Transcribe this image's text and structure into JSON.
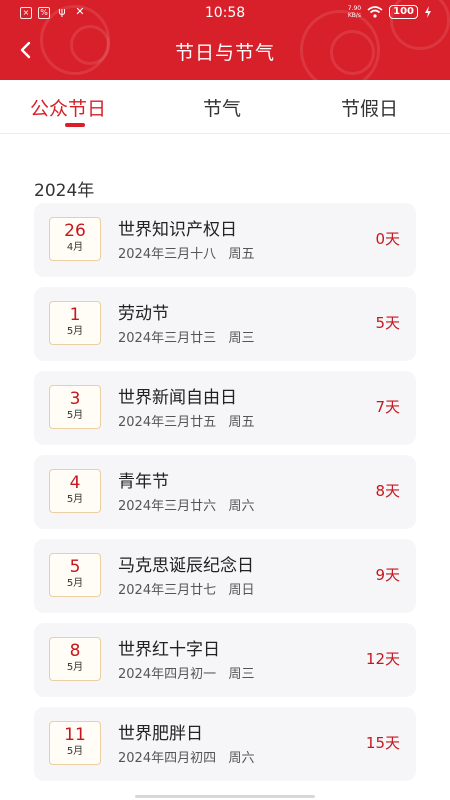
{
  "status_bar": {
    "time": "10:58",
    "net_speed_value": "7.90",
    "net_speed_unit": "KB/s",
    "battery": "100"
  },
  "header": {
    "title": "节日与节气",
    "back_icon": "chevron-left-icon",
    "color": "#d8202a"
  },
  "tabs": [
    {
      "label": "公众节日",
      "active": true
    },
    {
      "label": "节气",
      "active": false
    },
    {
      "label": "节假日",
      "active": false
    }
  ],
  "year_label": "2024年",
  "events": [
    {
      "day": "26",
      "month": "4月",
      "name": "世界知识产权日",
      "lunar": "2024年三月十八",
      "weekday": "周五",
      "countdown": "0天"
    },
    {
      "day": "1",
      "month": "5月",
      "name": "劳动节",
      "lunar": "2024年三月廿三",
      "weekday": "周三",
      "countdown": "5天"
    },
    {
      "day": "3",
      "month": "5月",
      "name": "世界新闻自由日",
      "lunar": "2024年三月廿五",
      "weekday": "周五",
      "countdown": "7天"
    },
    {
      "day": "4",
      "month": "5月",
      "name": "青年节",
      "lunar": "2024年三月廿六",
      "weekday": "周六",
      "countdown": "8天"
    },
    {
      "day": "5",
      "month": "5月",
      "name": "马克思诞辰纪念日",
      "lunar": "2024年三月廿七",
      "weekday": "周日",
      "countdown": "9天"
    },
    {
      "day": "8",
      "month": "5月",
      "name": "世界红十字日",
      "lunar": "2024年四月初一",
      "weekday": "周三",
      "countdown": "12天"
    },
    {
      "day": "11",
      "month": "5月",
      "name": "世界肥胖日",
      "lunar": "2024年四月初四",
      "weekday": "周六",
      "countdown": "15天"
    }
  ],
  "accent_color": "#c8161d"
}
